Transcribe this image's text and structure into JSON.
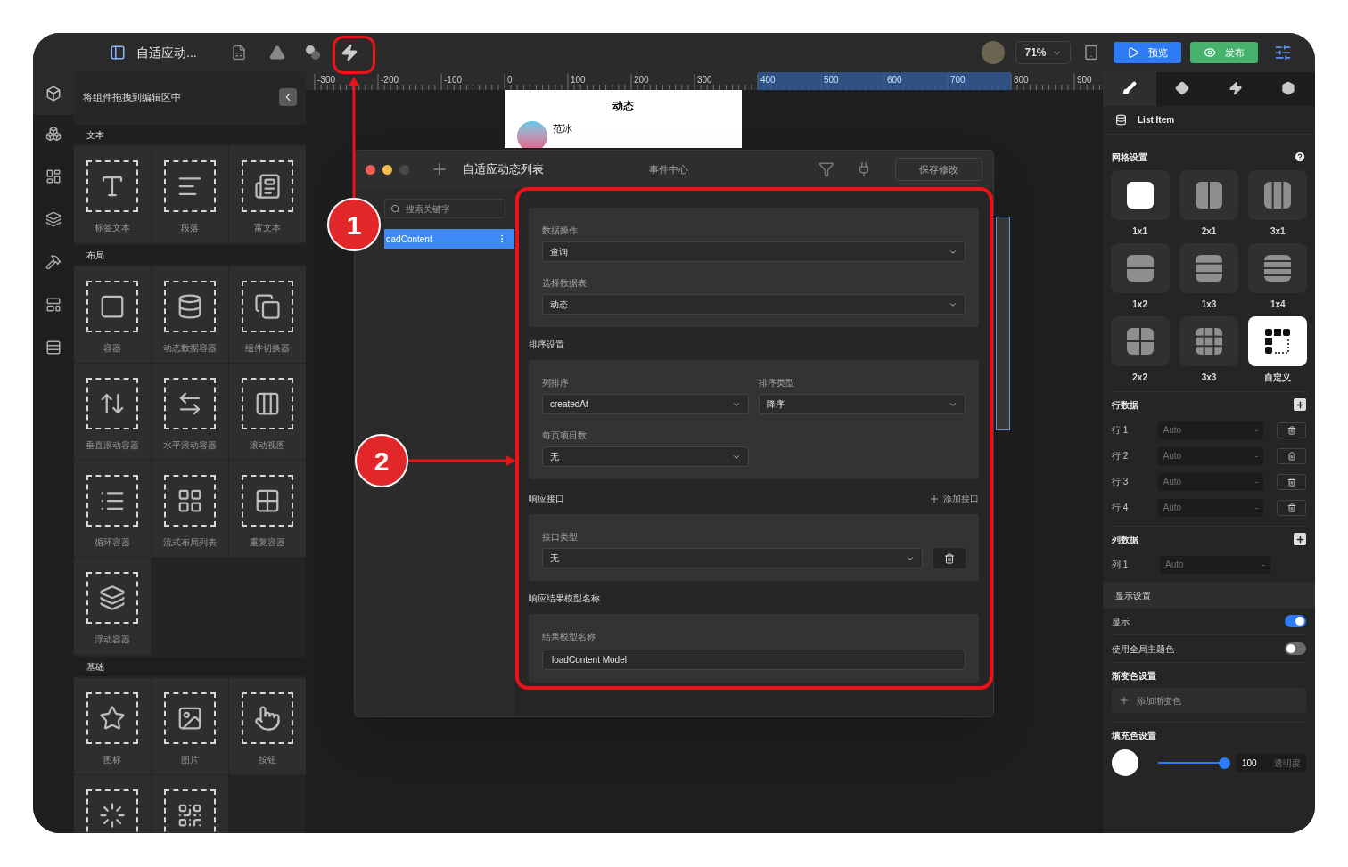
{
  "toolbar": {
    "title": "自适应动...",
    "zoom": "71%",
    "preview_button": "预览",
    "publish_button": "发布"
  },
  "components_panel": {
    "title": "将组件拖拽到编辑区中",
    "sections": [
      {
        "title": "文本",
        "items": [
          {
            "label": "标签文本"
          },
          {
            "label": "段落"
          },
          {
            "label": "富文本"
          }
        ]
      },
      {
        "title": "布局",
        "items": [
          {
            "label": "容器"
          },
          {
            "label": "动态数据容器"
          },
          {
            "label": "组件切换器"
          },
          {
            "label": "垂直滚动容器"
          },
          {
            "label": "水平滚动容器"
          },
          {
            "label": "滚动视图"
          },
          {
            "label": "循环容器"
          },
          {
            "label": "流式布局列表"
          },
          {
            "label": "重复容器"
          },
          {
            "label": "浮动容器"
          }
        ]
      },
      {
        "title": "基础",
        "items": [
          {
            "label": "图标"
          },
          {
            "label": "图片"
          },
          {
            "label": "按钮"
          }
        ]
      }
    ]
  },
  "ruler": {
    "labels": [
      {
        "text": "-300",
        "selected": false
      },
      {
        "text": "-200",
        "selected": false
      },
      {
        "text": "-100",
        "selected": false
      },
      {
        "text": "0",
        "selected": false
      },
      {
        "text": "100",
        "selected": false
      },
      {
        "text": "200",
        "selected": false
      },
      {
        "text": "300",
        "selected": false
      },
      {
        "text": "400",
        "selected": true
      },
      {
        "text": "500",
        "selected": true
      },
      {
        "text": "600",
        "selected": true
      },
      {
        "text": "700",
        "selected": true
      },
      {
        "text": "800",
        "selected": false
      },
      {
        "text": "900",
        "selected": false
      }
    ]
  },
  "preview": {
    "title": "动态",
    "author": "范冰"
  },
  "dialog": {
    "title": "自适应动态列表",
    "center_label": "事件中心",
    "save_button": "保存修改",
    "search_placeholder": "搜索关键字",
    "events": [
      {
        "name": "oadContent",
        "selected": true
      }
    ],
    "data_card": {
      "fields": [
        {
          "label": "数据操作",
          "value": "查询"
        },
        {
          "label": "选择数据表",
          "value": "动态"
        }
      ]
    },
    "sort": {
      "heading": "排序设置",
      "fields": [
        {
          "label": "列排序",
          "value": "createdAt"
        },
        {
          "label": "排序类型",
          "value": "降序"
        },
        {
          "label": "每页项目数",
          "value": "无"
        }
      ]
    },
    "response": {
      "heading": "响应接口",
      "add_button": "添加接口",
      "fields": [
        {
          "label": "接口类型",
          "value": "无"
        }
      ]
    },
    "result_model": {
      "heading": "响应结果模型名称",
      "fields": [
        {
          "label": "结果模型名称",
          "value": "loadContent Model"
        }
      ]
    }
  },
  "annotations": [
    {
      "number": "1"
    },
    {
      "number": "2"
    }
  ],
  "inspector": {
    "tabs": [
      {
        "selected": true
      },
      {
        "selected": false
      },
      {
        "selected": false
      },
      {
        "selected": false
      }
    ],
    "element_name": "List Item",
    "grid": {
      "title": "网格设置",
      "options": [
        {
          "label": "1x1",
          "selected": false
        },
        {
          "label": "2x1",
          "selected": false
        },
        {
          "label": "3x1",
          "selected": false
        },
        {
          "label": "1x2",
          "selected": false
        },
        {
          "label": "1x3",
          "selected": false
        },
        {
          "label": "1x4",
          "selected": false
        },
        {
          "label": "2x2",
          "selected": false
        },
        {
          "label": "3x3",
          "selected": false
        },
        {
          "label": "自定义",
          "selected": true
        }
      ]
    },
    "rows": {
      "title": "行数据",
      "items": [
        {
          "label": "行 1",
          "placeholder": "Auto",
          "suffix": "-"
        },
        {
          "label": "行 2",
          "placeholder": "Auto",
          "suffix": "-"
        },
        {
          "label": "行 3",
          "placeholder": "Auto",
          "suffix": "-"
        },
        {
          "label": "行 4",
          "placeholder": "Auto",
          "suffix": "-"
        }
      ]
    },
    "columns": {
      "title": "列数据",
      "items": [
        {
          "label": "列 1",
          "placeholder": "Auto",
          "suffix": "-"
        }
      ]
    },
    "display": {
      "title": "显示设置",
      "toggles": [
        {
          "label": "显示",
          "on": true
        },
        {
          "label": "使用全局主题色",
          "on": false
        }
      ]
    },
    "gradient": {
      "title": "渐变色设置",
      "add_button": "添加渐变色"
    },
    "fill": {
      "title": "填充色设置",
      "opacity": {
        "level": 0.95,
        "value": "100",
        "unit": "透明度"
      }
    }
  }
}
